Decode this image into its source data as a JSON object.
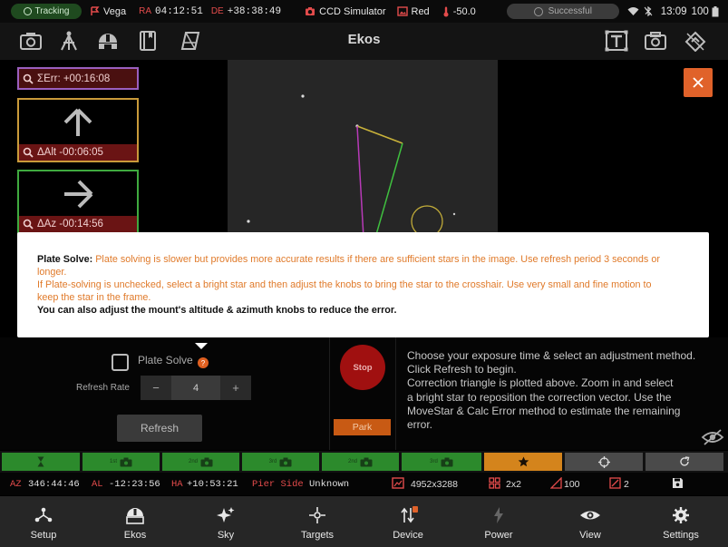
{
  "status_bar": {
    "tracking": "Tracking",
    "target": "Vega",
    "ra_label": "RA",
    "ra_value": "04:12:51",
    "de_label": "DE",
    "de_value": "+38:38:49",
    "camera": "CCD Simulator",
    "filter": "Red",
    "temperature": "-50.0",
    "solve_status": "Successful",
    "time": "13:09",
    "battery": "100"
  },
  "toolbar": {
    "title": "Ekos"
  },
  "guidance": {
    "total_error": "ΣErr: +00:16:08",
    "alt_error": "ΔAlt -00:06:05",
    "az_error": "ΔAz -00:14:56"
  },
  "tooltip": {
    "plate_solve_title": "Plate Solve:",
    "line1": "Plate solving is slower but provides more accurate results if there are sufficient stars in the image. Use refresh period 3 seconds or",
    "line2": "longer.",
    "line3": "If Plate-solving is unchecked, select a bright star and then adjust the knobs to bring the star to the crosshair. Use very small and fine motion to",
    "line4": "keep the star in the frame.",
    "line5": "You can also adjust the mount's altitude & azimuth knobs to reduce the error."
  },
  "controls": {
    "plate_solve_label": "Plate Solve",
    "help_badge": "?",
    "refresh_rate_label": "Refresh Rate",
    "minus": "−",
    "plus": "+",
    "refresh_rate_value": "4",
    "refresh_button": "Refresh",
    "stop_button": "Stop",
    "park_button": "Park"
  },
  "instructions": {
    "line1": "Choose your exposure time & select an adjustment method.",
    "line2": "Click Refresh to begin.",
    "line3": "Correction triangle is plotted above. Zoom in and select",
    "line4": "a bright star to reposition the correction vector. Use the",
    "line5": "MoveStar & Calc Error method to estimate the remaining",
    "line6": "error."
  },
  "action_bar": {
    "exposure_labels": [
      "1st",
      "2nd",
      "3rd",
      "2nd",
      "3rd"
    ]
  },
  "info_bar": {
    "az_label": "AZ",
    "az_value": "346:44:46",
    "al_label": "AL",
    "al_value": "-12:23:56",
    "ha_label": "HA",
    "ha_value": "+10:53:21",
    "pier_label": "Pier Side",
    "pier_value": "Unknown",
    "resolution": "4952x3288",
    "binning": "2x2",
    "gain": "100",
    "offset": "2"
  },
  "bottom_nav": {
    "setup": "Setup",
    "ekos": "Ekos",
    "sky": "Sky",
    "targets": "Targets",
    "device": "Device",
    "power": "Power",
    "view": "View",
    "settings": "Settings"
  },
  "colors": {
    "accent_orange": "#e0622a",
    "tracking_green": "#1f4a1f",
    "error_red": "#e34b4b",
    "action_green": "#2c8a2c"
  }
}
